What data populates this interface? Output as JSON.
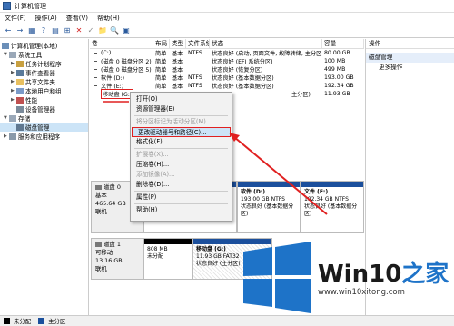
{
  "window": {
    "title": "计算机管理"
  },
  "menu": [
    "文件(F)",
    "操作(A)",
    "查看(V)",
    "帮助(H)"
  ],
  "toolbar": [
    "←",
    "→",
    "▦",
    "?",
    "▤",
    "⊞",
    "✕",
    "✓",
    "📁",
    "🔍",
    "▣"
  ],
  "tree": {
    "root": "计算机管理(本地)",
    "system_tools": "系统工具",
    "task_scheduler": "任务计划程序",
    "event_viewer": "事件查看器",
    "shared_folders": "共享文件夹",
    "local_users": "本地用户和组",
    "performance": "性能",
    "device_manager": "设备管理器",
    "storage": "存储",
    "disk_management": "磁盘管理",
    "services": "服务和应用程序"
  },
  "table": {
    "headers": [
      "卷",
      "布局",
      "类型",
      "文件系统",
      "状态",
      "容量"
    ],
    "rows": [
      [
        "(C:)",
        "简单",
        "基本",
        "NTFS",
        "状态良好 (启动, 页面文件, 故障转储, 主分区)",
        "80.00 GB"
      ],
      [
        "(磁盘 0 磁盘分区 2)",
        "简单",
        "基本",
        "",
        "状态良好 (EFI 系统分区)",
        "100 MB"
      ],
      [
        "(磁盘 0 磁盘分区 5)",
        "简单",
        "基本",
        "",
        "状态良好 (恢复分区)",
        "499 MB"
      ],
      [
        "软件 (D:)",
        "简单",
        "基本",
        "NTFS",
        "状态良好 (基本数据分区)",
        "193.00 GB"
      ],
      [
        "文件 (E:)",
        "简单",
        "基本",
        "NTFS",
        "状态良好 (基本数据分区)",
        "192.34 GB"
      ],
      [
        "移动盘 (G:)",
        "",
        "",
        "",
        "主分区)",
        "11.93 GB"
      ]
    ]
  },
  "context_menu": {
    "open": "打开(O)",
    "explorer": "资源管理器(E)",
    "mark_active": "将分区标记为活动分区(M)",
    "change_letter": "更改驱动器号和路径(C)...",
    "format": "格式化(F)...",
    "extend": "扩展卷(X)...",
    "shrink": "压缩卷(H)...",
    "mirror": "添加镜像(A)...",
    "delete": "删除卷(D)...",
    "properties": "属性(P)",
    "help": "帮助(H)"
  },
  "actions": {
    "header": "操作",
    "section": "磁盘管理",
    "more": "更多操作"
  },
  "disk0": {
    "name": "磁盘 0",
    "type": "基本",
    "size": "465.64 GB",
    "status": "联机",
    "software": {
      "name": "软件 (D:)",
      "size": "193.00 GB NTFS",
      "status": "状态良好 (基本数据分区)"
    },
    "files": {
      "name": "文件 (E:)",
      "size": "192.34 GB NTFS",
      "status": "状态良好 (基本数据分区)"
    }
  },
  "disk1": {
    "name": "磁盘 1",
    "type": "可移动",
    "size": "13.16 GB",
    "status": "联机",
    "unalloc": {
      "size": "808 MB",
      "label": "未分配"
    },
    "mobile": {
      "name": "移动盘 (G:)",
      "size": "11.93 GB FAT32",
      "status": "状态良好 (主分区)"
    }
  },
  "legend": [
    "未分配",
    "主分区"
  ],
  "watermark": {
    "brand": "Win10",
    "suffix": "之家",
    "url": "www.win10xitong.com"
  },
  "colors": {
    "accent": "#1e73c8",
    "red": "#e02020",
    "primary_bar": "#1b4f9c",
    "unalloc_bar": "#000000"
  }
}
